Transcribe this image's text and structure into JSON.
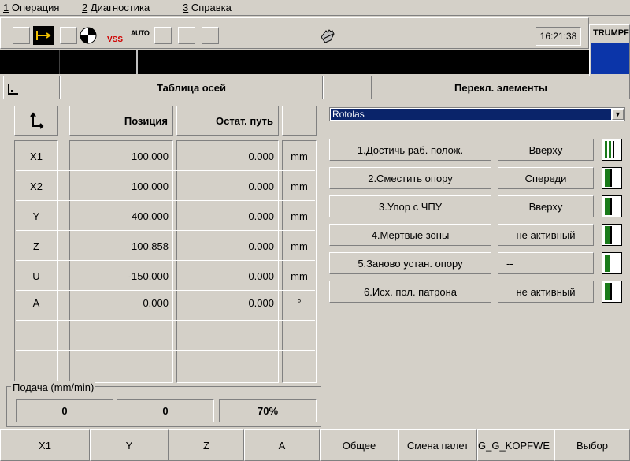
{
  "menu": {
    "items": [
      {
        "key": "1",
        "label": "Операция"
      },
      {
        "key": "2",
        "label": "Диагностика"
      },
      {
        "key": "3",
        "label": "Справка"
      }
    ]
  },
  "toolbar": {
    "vss_label": "VSS",
    "auto_label": "AUTO",
    "clock": "16:21:38",
    "brand": "TRUMPF"
  },
  "left_panel": {
    "title": "Таблица осей",
    "columns": {
      "position": "Позиция",
      "remaining": "Остат. путь"
    },
    "rows": [
      {
        "axis": "X1",
        "position": "100.000",
        "remaining": "0.000",
        "unit": "mm"
      },
      {
        "axis": "X2",
        "position": "100.000",
        "remaining": "0.000",
        "unit": "mm"
      },
      {
        "axis": "Y",
        "position": "400.000",
        "remaining": "0.000",
        "unit": "mm"
      },
      {
        "axis": "Z",
        "position": "100.858",
        "remaining": "0.000",
        "unit": "mm"
      },
      {
        "axis": "U",
        "position": "-150.000",
        "remaining": "0.000",
        "unit": "mm"
      },
      {
        "axis": "A",
        "position": "0.000",
        "remaining": "0.000",
        "unit": "°"
      }
    ],
    "feed": {
      "label": "Подача (mm/min)",
      "values": [
        "0",
        "0",
        "70%"
      ]
    }
  },
  "right_panel": {
    "title": "Перекл. элементы",
    "dropdown_value": "Rotolas",
    "elements": [
      {
        "label": "1.Достичь раб. полож.",
        "state": "Вверху"
      },
      {
        "label": "2.Сместить опору",
        "state": "Спереди"
      },
      {
        "label": "3.Упор с ЧПУ",
        "state": "Вверху"
      },
      {
        "label": "4.Мертвые зоны",
        "state": "не активный"
      },
      {
        "label": "5.Заново устан. опору",
        "state": "--"
      },
      {
        "label": "6.Исх. пол. патрона",
        "state": "не активный"
      }
    ]
  },
  "function_keys": [
    "X1",
    "Y",
    "Z",
    "A",
    "Общее",
    "Смена палет",
    "G_G_KOPFWE",
    "Выбор"
  ],
  "colors": {
    "background": "#d4d0c8",
    "selection": "#0a246a",
    "brand_blue": "#0b35a9",
    "switch_green": "#1a7a1a",
    "vss_red": "#d00000"
  }
}
